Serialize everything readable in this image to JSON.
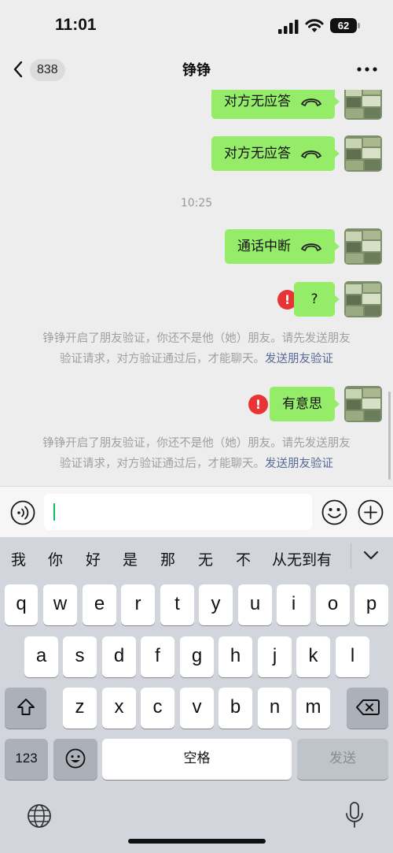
{
  "status_bar": {
    "time": "11:01",
    "battery": "62"
  },
  "nav": {
    "unread_count": "838",
    "title": "铮铮"
  },
  "messages": [
    {
      "text": "对方无应答",
      "type": "call"
    },
    {
      "text": "对方无应答",
      "type": "call"
    },
    {
      "text": "通话中断",
      "type": "call"
    },
    {
      "text": "?",
      "type": "text",
      "failed": true
    },
    {
      "text": "有意思",
      "type": "text",
      "failed": true
    }
  ],
  "time_separator": "10:25",
  "system_notice": {
    "line1": "铮铮开启了朋友验证，你还不是他（她）朋友。请先发送朋友",
    "line2": "验证请求，对方验证通过后，才能聊天。",
    "link": "发送朋友验证"
  },
  "input": {
    "value": ""
  },
  "keyboard": {
    "candidates": [
      "我",
      "你",
      "好",
      "是",
      "那",
      "无",
      "不",
      "从无到有"
    ],
    "row1": [
      "q",
      "w",
      "e",
      "r",
      "t",
      "y",
      "u",
      "i",
      "o",
      "p"
    ],
    "row2": [
      "a",
      "s",
      "d",
      "f",
      "g",
      "h",
      "j",
      "k",
      "l"
    ],
    "row3": [
      "z",
      "x",
      "c",
      "v",
      "b",
      "n",
      "m"
    ],
    "numbers_key": "123",
    "space_key": "空格",
    "send_key": "发送"
  },
  "colors": {
    "bubble_green": "#95ec69",
    "background": "#ededed",
    "link_blue": "#576b95",
    "error_red": "#e83434"
  }
}
